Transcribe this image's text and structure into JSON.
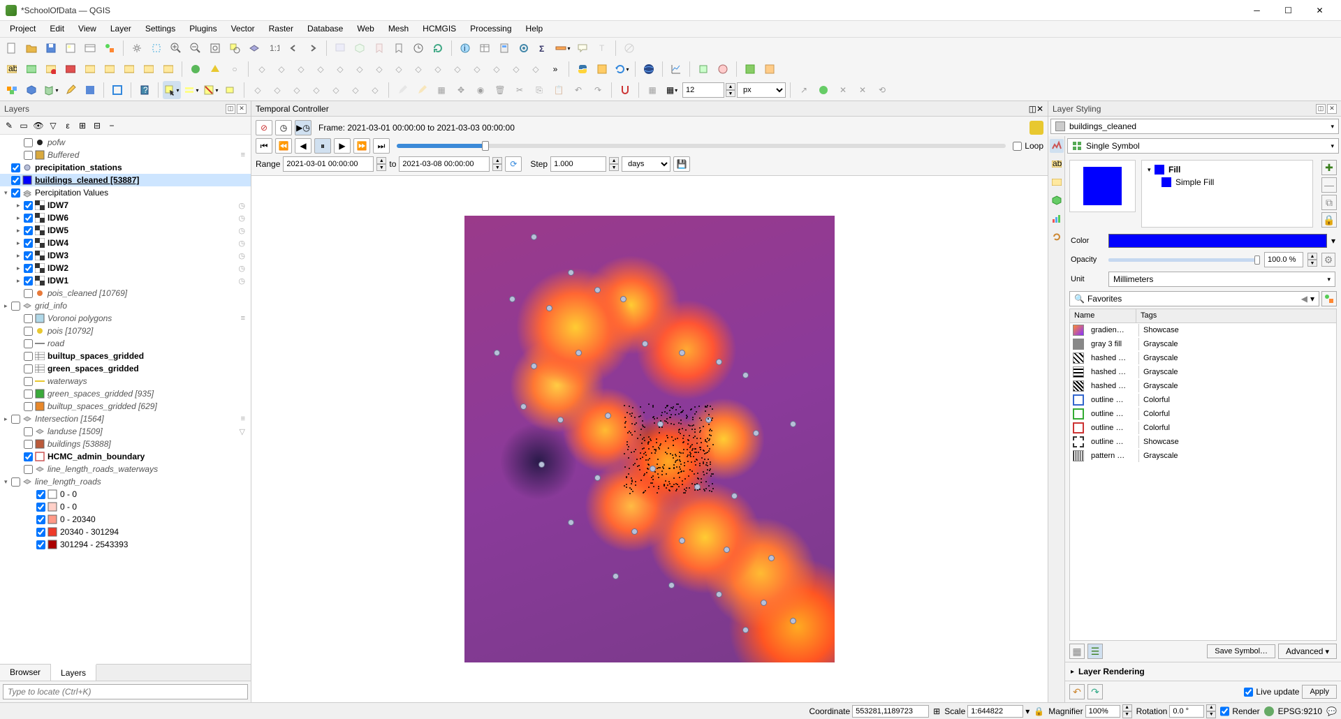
{
  "title": "*SchoolOfData — QGIS",
  "menus": [
    "Project",
    "Edit",
    "View",
    "Layer",
    "Settings",
    "Plugins",
    "Vector",
    "Raster",
    "Database",
    "Web",
    "Mesh",
    "HCMGIS",
    "Processing",
    "Help"
  ],
  "panels": {
    "layers_title": "Layers",
    "temporal_title": "Temporal Controller",
    "styling_title": "Layer Styling"
  },
  "temporal": {
    "frame_label": "Frame: 2021-03-01 00:00:00 to 2021-03-03 00:00:00",
    "range_label": "Range",
    "range_from": "2021-03-01 00:00:00",
    "to_label": "to",
    "range_to": "2021-03-08 00:00:00",
    "step_label": "Step",
    "step_value": "1.000",
    "step_unit": "days",
    "loop_label": "Loop"
  },
  "layers": [
    {
      "indent": 1,
      "cb": false,
      "icon": "point-black",
      "label": "pofw",
      "italic": true
    },
    {
      "indent": 1,
      "cb": false,
      "icon": "sq",
      "color": "#d9a93e",
      "label": "Buffered",
      "italic": true,
      "right": "≡"
    },
    {
      "indent": 0,
      "arrow": "",
      "cb": true,
      "icon": "point-gray",
      "label": "precipitation_stations",
      "bold": true
    },
    {
      "indent": 0,
      "arrow": "",
      "cb": true,
      "icon": "sq",
      "color": "#0000ff",
      "label": "buildings_cleaned [53887]",
      "bold": true,
      "selected": true
    },
    {
      "indent": 0,
      "arrow": "▾",
      "cb": true,
      "icon": "group",
      "label": "Percipitation Values"
    },
    {
      "indent": 1,
      "arrow": "▸",
      "cb": true,
      "icon": "raster",
      "label": "IDW7",
      "bold": true,
      "right": "◷"
    },
    {
      "indent": 1,
      "arrow": "▸",
      "cb": true,
      "icon": "raster",
      "label": "IDW6",
      "bold": true,
      "right": "◷"
    },
    {
      "indent": 1,
      "arrow": "▸",
      "cb": true,
      "icon": "raster",
      "label": "IDW5",
      "bold": true,
      "right": "◷"
    },
    {
      "indent": 1,
      "arrow": "▸",
      "cb": true,
      "icon": "raster",
      "label": "IDW4",
      "bold": true,
      "right": "◷"
    },
    {
      "indent": 1,
      "arrow": "▸",
      "cb": true,
      "icon": "raster",
      "label": "IDW3",
      "bold": true,
      "right": "◷"
    },
    {
      "indent": 1,
      "arrow": "▸",
      "cb": true,
      "icon": "raster",
      "label": "IDW2",
      "bold": true,
      "right": "◷"
    },
    {
      "indent": 1,
      "arrow": "▸",
      "cb": true,
      "icon": "raster",
      "label": "IDW1",
      "bold": true,
      "right": "◷"
    },
    {
      "indent": 1,
      "cb": false,
      "icon": "point-orange",
      "label": "pois_cleaned [10769]",
      "italic": true
    },
    {
      "indent": 0,
      "arrow": "▸",
      "cb": false,
      "icon": "poly-gray",
      "label": "grid_info",
      "italic": true
    },
    {
      "indent": 1,
      "cb": false,
      "icon": "sq",
      "color": "#b0d8e8",
      "label": "Voronoi polygons",
      "italic": true,
      "right": "≡"
    },
    {
      "indent": 1,
      "cb": false,
      "icon": "point-yellow",
      "label": "pois [10792]",
      "italic": true
    },
    {
      "indent": 1,
      "cb": false,
      "icon": "line",
      "label": "road",
      "italic": true
    },
    {
      "indent": 1,
      "cb": false,
      "icon": "table",
      "label": "builtup_spaces_gridded",
      "bold": true
    },
    {
      "indent": 1,
      "cb": false,
      "icon": "table",
      "label": "green_spaces_gridded",
      "bold": true
    },
    {
      "indent": 1,
      "cb": false,
      "icon": "line-yellow",
      "label": "waterways",
      "italic": true
    },
    {
      "indent": 1,
      "cb": false,
      "icon": "sq",
      "color": "#3aaa3a",
      "label": "green_spaces_gridded [935]",
      "italic": true
    },
    {
      "indent": 1,
      "cb": false,
      "icon": "sq",
      "color": "#e8882a",
      "label": "builtup_spaces_gridded [629]",
      "italic": true
    },
    {
      "indent": 0,
      "arrow": "▸",
      "cb": false,
      "icon": "poly-gray",
      "label": "Intersection [1564]",
      "italic": true,
      "right": "≡"
    },
    {
      "indent": 1,
      "cb": false,
      "icon": "poly-gray",
      "label": "landuse [1509]",
      "italic": true,
      "right": "▽"
    },
    {
      "indent": 1,
      "cb": false,
      "icon": "sq",
      "color": "#bb5a3a",
      "label": "buildings [53888]",
      "italic": true
    },
    {
      "indent": 1,
      "cb": true,
      "icon": "sq-outline",
      "label": "HCMC_admin_boundary",
      "bold": true
    },
    {
      "indent": 1,
      "cb": false,
      "icon": "poly-gray",
      "label": "line_length_roads_waterways",
      "italic": true
    },
    {
      "indent": 0,
      "arrow": "▾",
      "cb": false,
      "icon": "poly-gray",
      "label": "line_length_roads",
      "italic": true
    },
    {
      "indent": 2,
      "cb": true,
      "icon": "sq",
      "color": "#ffffff",
      "label": "0 - 0"
    },
    {
      "indent": 2,
      "cb": true,
      "icon": "sq",
      "color": "#ffd0c8",
      "label": "0 - 0"
    },
    {
      "indent": 2,
      "cb": true,
      "icon": "sq",
      "color": "#ff9a88",
      "label": "0 - 20340"
    },
    {
      "indent": 2,
      "cb": true,
      "icon": "sq",
      "color": "#ee3a2a",
      "label": "20340 - 301294"
    },
    {
      "indent": 2,
      "cb": true,
      "icon": "sq",
      "color": "#aa0000",
      "label": "301294 - 2543393"
    }
  ],
  "layers_tabs": {
    "browser": "Browser",
    "layers": "Layers"
  },
  "locator_placeholder": "Type to locate (Ctrl+K)",
  "styling": {
    "layer_combo": "buildings_cleaned",
    "renderer_combo": "Single Symbol",
    "fill_label": "Fill",
    "simple_fill_label": "Simple Fill",
    "color_label": "Color",
    "opacity_label": "Opacity",
    "opacity_value": "100.0 %",
    "unit_label": "Unit",
    "unit_value": "Millimeters",
    "search_placeholder": "Favorites",
    "cols": {
      "name": "Name",
      "tags": "Tags"
    },
    "symbols": [
      {
        "name": "gradien…",
        "tags": "Showcase",
        "icon": "grad"
      },
      {
        "name": "gray 3 fill",
        "tags": "Grayscale",
        "icon": "gray"
      },
      {
        "name": "hashed …",
        "tags": "Grayscale",
        "icon": "hash1"
      },
      {
        "name": "hashed …",
        "tags": "Grayscale",
        "icon": "hash2"
      },
      {
        "name": "hashed …",
        "tags": "Grayscale",
        "icon": "hash3"
      },
      {
        "name": "outline …",
        "tags": "Colorful",
        "icon": "out-blue"
      },
      {
        "name": "outline …",
        "tags": "Colorful",
        "icon": "out-green"
      },
      {
        "name": "outline …",
        "tags": "Colorful",
        "icon": "out-red"
      },
      {
        "name": "outline …",
        "tags": "Showcase",
        "icon": "out-dash"
      },
      {
        "name": "pattern …",
        "tags": "Grayscale",
        "icon": "pattern"
      }
    ],
    "save_symbol": "Save Symbol…",
    "advanced": "Advanced",
    "layer_rendering": "Layer Rendering",
    "live_update": "Live update",
    "apply": "Apply"
  },
  "toolbar_input": {
    "font_size": "12",
    "font_unit": "px"
  },
  "status": {
    "coordinate_label": "Coordinate",
    "coordinate": "553281,1189723",
    "scale_label": "Scale",
    "scale": "1:644822",
    "magnifier_label": "Magnifier",
    "magnifier": "100%",
    "rotation_label": "Rotation",
    "rotation": "0.0 °",
    "render_label": "Render",
    "crs": "EPSG:9210"
  }
}
